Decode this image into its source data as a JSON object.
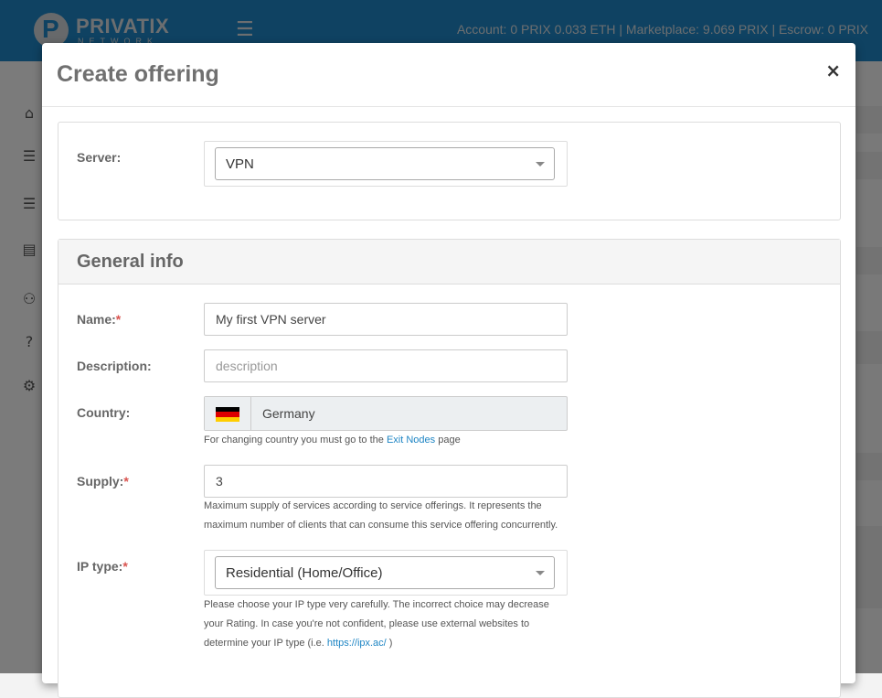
{
  "brand": {
    "name": "PRIVATIX",
    "sub": "NETWORK"
  },
  "header": {
    "account_text": "Account: 0 PRIX  0.033 ETH | Marketplace: 9.069 PRIX | Escrow: 0 PRIX"
  },
  "modal": {
    "title": "Create offering",
    "close_label": "×",
    "server": {
      "label": "Server:",
      "value": "VPN"
    },
    "general": {
      "title": "General info",
      "name": {
        "label": "Name:",
        "required": "*",
        "value": "My first VPN server"
      },
      "description": {
        "label": "Description:",
        "placeholder": "description"
      },
      "country": {
        "label": "Country:",
        "value": "Germany",
        "help_prefix": "For changing country you must go to the ",
        "help_link": "Exit Nodes",
        "help_suffix": " page"
      },
      "supply": {
        "label": "Supply:",
        "required": "*",
        "value": "3",
        "help_line1": "Maximum supply of services according to service offerings. It represents the",
        "help_line2": "maximum number of clients that can consume this service offering concurrently."
      },
      "ip_type": {
        "label": "IP type:",
        "required": "*",
        "value": "Residential (Home/Office)",
        "help_line1": "Please choose your IP type very carefully. The incorrect choice may decrease",
        "help_line2": "your Rating. In case you're not confident, please use external websites to",
        "help_line3_prefix": "determine your IP type (i.e. ",
        "help_link": "https://ipx.ac/",
        "help_line3_suffix": " )"
      }
    }
  },
  "colors": {
    "topbar": "#1e85c4",
    "link": "#1e85c4",
    "required": "#d9534f"
  }
}
